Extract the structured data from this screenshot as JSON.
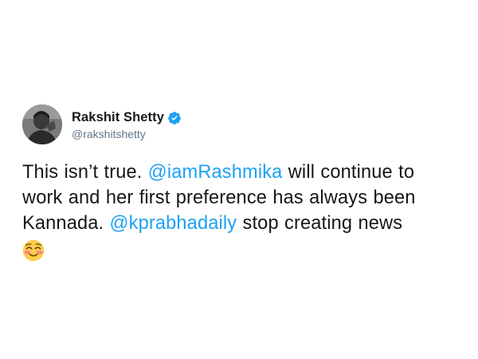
{
  "tweet": {
    "author": {
      "display_name": "Rakshit Shetty",
      "handle": "@rakshitshetty",
      "verified": true
    },
    "body": {
      "line1_a": "This isn’t true. ",
      "mention1": "@iamRashmika",
      "line1_b": " will continue to",
      "line2": "work and her first preference has always been",
      "line3_a": "Kannada. ",
      "mention2": "@kprabhadaily",
      "line3_b": " stop creating news"
    },
    "emoji": "smiling-face-with-smiling-eyes",
    "colors": {
      "text": "#14171a",
      "muted": "#657786",
      "link": "#1da1f2",
      "verified": "#1da1f2"
    }
  }
}
